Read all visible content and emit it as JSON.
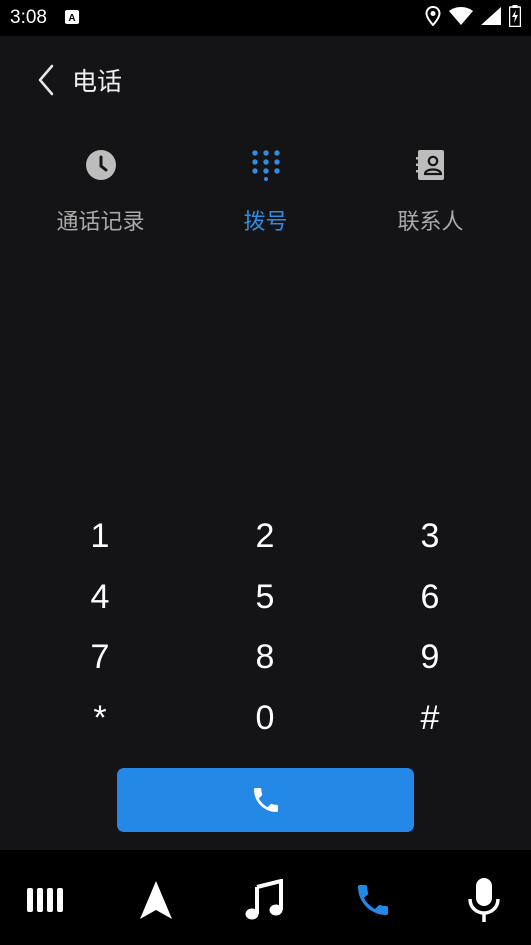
{
  "status_bar": {
    "time": "3:08",
    "icons": [
      "text-notification-icon",
      "location-icon",
      "wifi-icon",
      "signal-icon",
      "battery-charging-icon"
    ]
  },
  "header": {
    "title": "电话",
    "back_icon": "chevron-left-icon"
  },
  "tabs": [
    {
      "label": "通话记录",
      "icon": "clock-icon",
      "active": false
    },
    {
      "label": "拨号",
      "icon": "dialpad-icon",
      "active": true
    },
    {
      "label": "联系人",
      "icon": "contacts-icon",
      "active": false
    }
  ],
  "keypad": {
    "keys": [
      "1",
      "2",
      "3",
      "4",
      "5",
      "6",
      "7",
      "8",
      "9",
      "*",
      "0",
      "#"
    ]
  },
  "call_button": {
    "icon": "phone-icon"
  },
  "bottom_nav": [
    {
      "name": "apps",
      "icon": "app-grid-icon",
      "active": false
    },
    {
      "name": "navigation",
      "icon": "navigation-arrow-icon",
      "active": false
    },
    {
      "name": "music",
      "icon": "music-note-icon",
      "active": false
    },
    {
      "name": "phone",
      "icon": "phone-icon",
      "active": true
    },
    {
      "name": "voice",
      "icon": "microphone-icon",
      "active": false
    }
  ],
  "colors": {
    "background": "#141416",
    "accent": "#2388e6",
    "inactive_label": "#a9a9a9",
    "bars": "#000000"
  }
}
